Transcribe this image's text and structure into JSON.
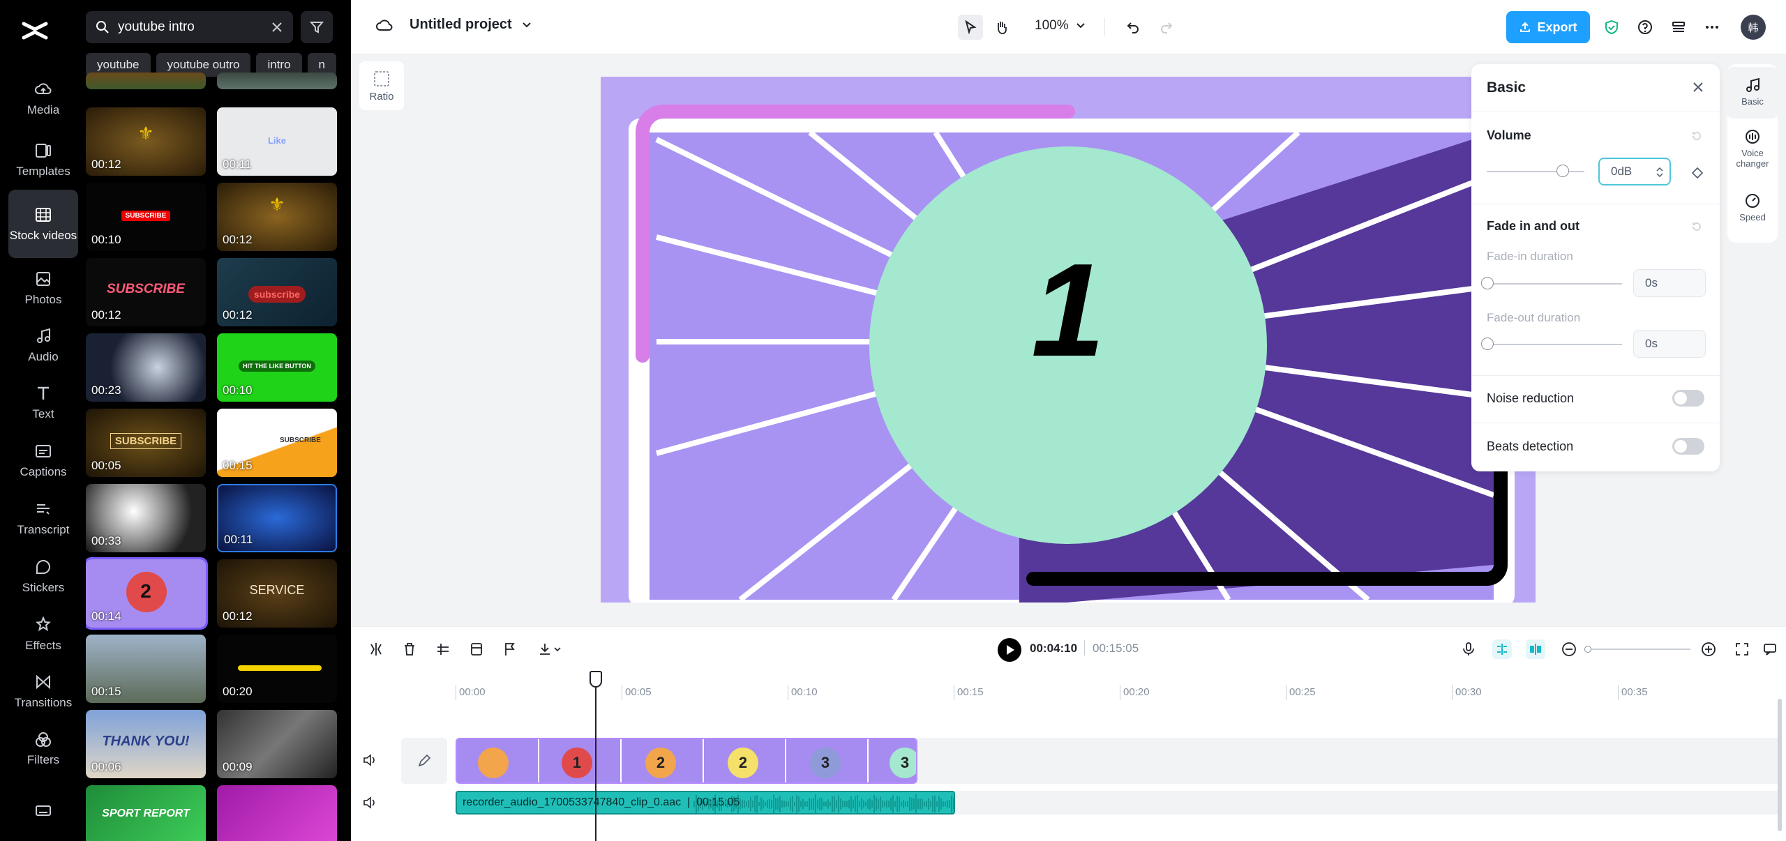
{
  "rail": {
    "items": [
      {
        "label": "Media",
        "icon": "cloud-upload-icon"
      },
      {
        "label": "Templates",
        "icon": "templates-icon"
      },
      {
        "label": "Stock videos",
        "icon": "stock-videos-icon"
      },
      {
        "label": "Photos",
        "icon": "photos-icon"
      },
      {
        "label": "Audio",
        "icon": "music-note-icon"
      },
      {
        "label": "Text",
        "icon": "text-icon"
      },
      {
        "label": "Captions",
        "icon": "captions-icon"
      },
      {
        "label": "Transcript",
        "icon": "transcript-icon"
      },
      {
        "label": "Stickers",
        "icon": "stickers-icon"
      },
      {
        "label": "Effects",
        "icon": "effects-icon"
      },
      {
        "label": "Transitions",
        "icon": "transitions-icon"
      },
      {
        "label": "Filters",
        "icon": "filters-icon"
      }
    ],
    "active_index": 2
  },
  "panel": {
    "search_value": "youtube intro",
    "chips": [
      "youtube",
      "youtube outro",
      "intro",
      "n"
    ],
    "thumbnails": [
      {
        "duration": "00:12",
        "caption": ""
      },
      {
        "duration": "00:11",
        "caption": "Like"
      },
      {
        "duration": "00:10",
        "caption": "SUBSCRIBE"
      },
      {
        "duration": "00:12",
        "caption": ""
      },
      {
        "duration": "00:12",
        "caption": "SUBSCRIBE"
      },
      {
        "duration": "00:12",
        "caption": "subscribe"
      },
      {
        "duration": "00:23",
        "caption": ""
      },
      {
        "duration": "00:10",
        "caption": "HIT THE LIKE BUTTON"
      },
      {
        "duration": "00:05",
        "caption": "SUBSCRIBE"
      },
      {
        "duration": "00:15",
        "caption": "SUBSCRIBE"
      },
      {
        "duration": "00:33",
        "caption": ""
      },
      {
        "duration": "00:11",
        "caption": ""
      },
      {
        "duration": "00:14",
        "caption": "2"
      },
      {
        "duration": "00:12",
        "caption": "SERVICE"
      },
      {
        "duration": "00:15",
        "caption": ""
      },
      {
        "duration": "00:20",
        "caption": ""
      },
      {
        "duration": "00:06",
        "caption": "THANK YOU!"
      },
      {
        "duration": "00:09",
        "caption": ""
      },
      {
        "duration": "",
        "caption": "SPORT REPORT"
      },
      {
        "duration": "",
        "caption": ""
      }
    ]
  },
  "topbar": {
    "project_title": "Untitled project",
    "zoom": "100%",
    "export_label": "Export",
    "avatar_initial": "韩"
  },
  "stage": {
    "ratio_label": "Ratio",
    "preview_number": "1"
  },
  "props": {
    "title": "Basic",
    "volume_label": "Volume",
    "volume_value": "0dB",
    "volume_level": 0.78,
    "fade_label": "Fade in and out",
    "fade_in_label": "Fade-in duration",
    "fade_in_value": "0s",
    "fade_out_label": "Fade-out duration",
    "fade_out_value": "0s",
    "noise_label": "Noise reduction",
    "noise_on": false,
    "beats_label": "Beats detection",
    "beats_on": false
  },
  "side_tabs": [
    {
      "label": "Basic",
      "icon": "music-note-icon"
    },
    {
      "label": "Voice changer",
      "icon": "voice-changer-icon"
    },
    {
      "label": "Speed",
      "icon": "speed-icon"
    }
  ],
  "timeline": {
    "current_time": "00:04:10",
    "total_time": "00:15:05",
    "ruler_ticks": [
      "00:00",
      "00:05",
      "00:10",
      "00:15",
      "00:20",
      "00:25",
      "00:30",
      "00:35"
    ],
    "clip_numbers": [
      "",
      "1",
      "2",
      "2",
      "3",
      "3"
    ],
    "audio_clip_name": "recorder_audio_1700533747840_clip_0.aac",
    "audio_clip_duration": "00:15:05"
  },
  "colors": {
    "accent": "#1da0ff",
    "clip_purple": "#9d89e8",
    "audio_teal": "#1fbfb8",
    "preview_mint": "#a3e8cf"
  }
}
